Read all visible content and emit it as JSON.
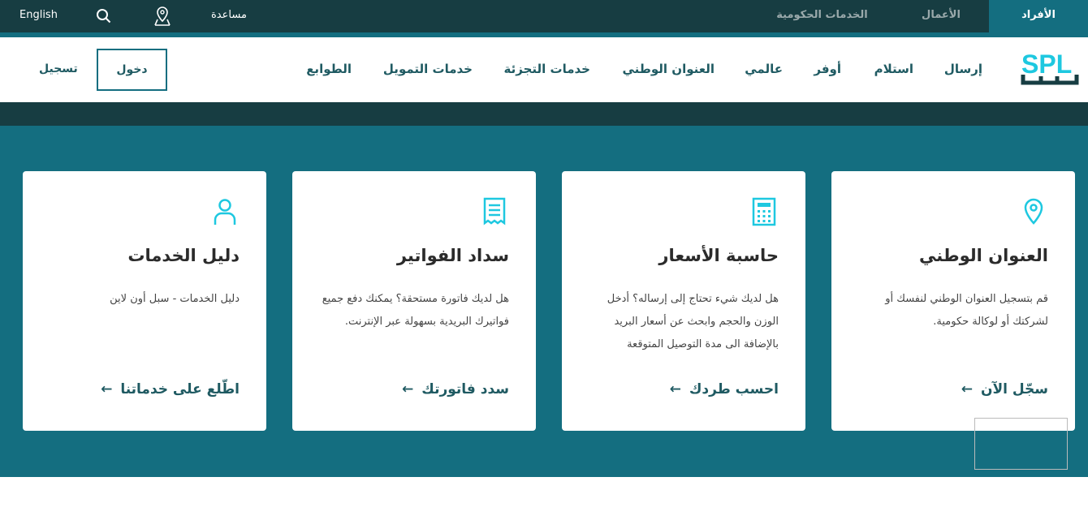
{
  "topbar": {
    "tabs": [
      {
        "label": "الأفراد",
        "active": true
      },
      {
        "label": "الأعمال"
      },
      {
        "label": "الخدمات الحكومية"
      }
    ],
    "help": "مساعدة",
    "language": "English",
    "icons": [
      "location-pin-icon",
      "search-icon"
    ]
  },
  "nav": {
    "logo": "SPL سبل",
    "items": [
      "إرسال",
      "استلام",
      "أوفر",
      "عالمي",
      "العنوان الوطني",
      "خدمات التجزئة",
      "خدمات التمويل",
      "الطوابع"
    ],
    "login": "دخول",
    "register": "تسجيل"
  },
  "cards": [
    {
      "icon": "location-pin-icon",
      "title": "العنوان الوطني",
      "description": "قم بتسجيل العنوان الوطني لنفسك أو لشركتك أو لوكالة حكومية.",
      "link": "سجّل الآن"
    },
    {
      "icon": "calculator-icon",
      "title": "حاسبة الأسعار",
      "description": "هل لديك شيء تحتاج إلى إرساله؟ أدخل الوزن والحجم وابحث عن أسعار البريد بالإضافة الى مدة التوصيل المتوقعة",
      "link": "احسب طردك"
    },
    {
      "icon": "receipt-icon",
      "title": "سداد الفواتير",
      "description": "هل لديك فاتورة مستحقة؟ يمكنك دفع جميع فواتيرك البريدية بسهولة عبر الإنترنت.",
      "link": "سدد فاتورتك"
    },
    {
      "icon": "user-icon",
      "title": "دليل الخدمات",
      "description": "دليل الخدمات - سبل أون لاين",
      "link": "اطّلع على خدماتنا"
    }
  ],
  "colors": {
    "dark": "#173d42",
    "teal": "#146e80",
    "accent": "#1ec8e0"
  }
}
